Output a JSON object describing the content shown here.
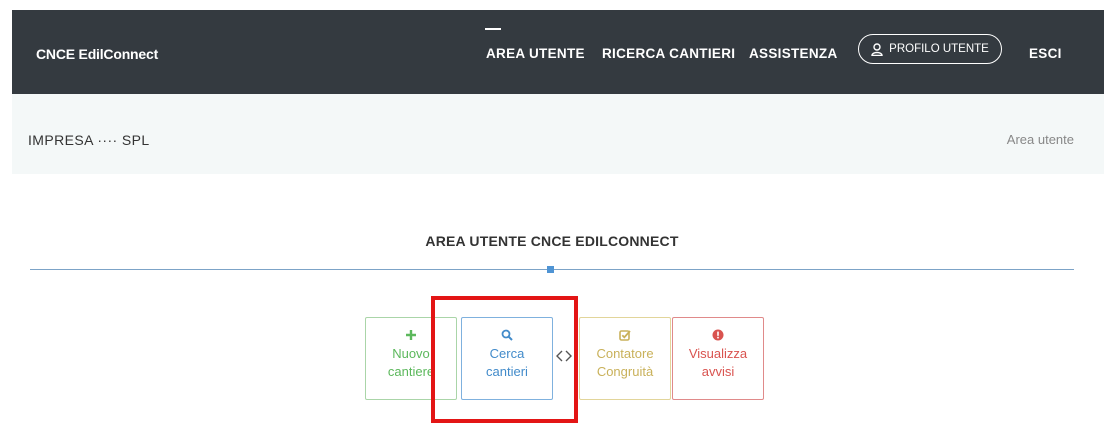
{
  "header": {
    "brand": "CNCE EdilConnect",
    "nav": {
      "area_utente": "AREA UTENTE",
      "ricerca_cantieri": "RICERCA CANTIERI",
      "assistenza": "ASSISTENZA",
      "profilo_utente": "PROFILO UTENTE",
      "esci": "ESCI"
    },
    "active_item": "AREA UTENTE"
  },
  "subheader": {
    "company": "IMPRESA ···· SPL",
    "breadcrumb": "Area utente"
  },
  "main": {
    "section_title": "AREA UTENTE CNCE EDILCONNECT",
    "tiles": [
      {
        "line1": "Nuovo",
        "line2": "cantiere",
        "icon": "plus-icon",
        "color": "#5cb85c"
      },
      {
        "line1": "Cerca",
        "line2": "cantieri",
        "icon": "search-icon",
        "color": "#428bca"
      },
      {
        "line1": "Contatore",
        "line2": "Congruità",
        "icon": "check-square-icon",
        "color": "#c9b15a"
      },
      {
        "line1": "Visualizza",
        "line2": "avvisi",
        "icon": "alert-circle-icon",
        "color": "#d9534f"
      }
    ]
  },
  "colors": {
    "header_bg": "#343a40",
    "subheader_bg": "#f4f8f8",
    "highlight": "#e31515"
  }
}
